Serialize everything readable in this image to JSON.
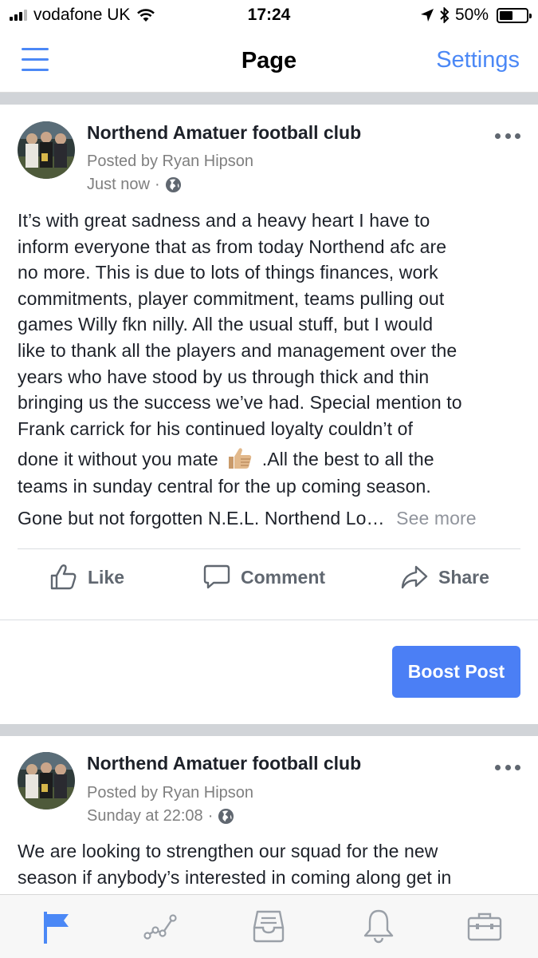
{
  "status_bar": {
    "carrier": "vodafone UK",
    "time": "17:24",
    "battery_percent": "50%",
    "battery_level": 0.5
  },
  "nav": {
    "title": "Page",
    "settings_label": "Settings"
  },
  "posts": [
    {
      "page_name": "Northend Amatuer football club",
      "posted_by": "Posted by Ryan Hipson",
      "timestamp": "Just now",
      "separator_dot": "·",
      "text_lines": [
        "It’s with great sadness and a heavy heart I have to",
        "inform everyone that as from today Northend afc are",
        "no more. This is due to lots of things finances, work",
        "commitments, player commitment, teams pulling out",
        "games Willy fkn nilly. All the usual stuff, but I would",
        "like to thank all the players and management over the",
        "years who have stood by us through thick and thin",
        "bringing us the success we’ve had. Special mention to",
        "Frank carrick for his continued loyalty couldn’t of"
      ],
      "line_emoji_before": "done it without you mate",
      "line_emoji_after": ".All the best to all the",
      "line_11": "teams in sunday central for the up coming season.",
      "line_12": "Gone but not forgotten N.E.L. Northend Lo…",
      "see_more": "See more",
      "actions": {
        "like": "Like",
        "comment": "Comment",
        "share": "Share"
      },
      "boost_label": "Boost Post"
    },
    {
      "page_name": "Northend Amatuer football club",
      "posted_by": "Posted by Ryan Hipson",
      "timestamp": "Sunday at 22:08",
      "separator_dot": "·",
      "text_lines": [
        "We are looking to strengthen our squad for the new",
        "season if anybody’s interested in coming along get in"
      ]
    }
  ],
  "colors": {
    "accent": "#4b88f6",
    "boost": "#4b7ff5",
    "separator": "#d1d4d8",
    "secondary_text": "#7f7f7f",
    "action_text": "#606770"
  },
  "tab_bar": {
    "tabs": [
      "flag-icon",
      "insights-icon",
      "inbox-icon",
      "bell-icon",
      "briefcase-icon"
    ],
    "active": "flag-icon"
  }
}
